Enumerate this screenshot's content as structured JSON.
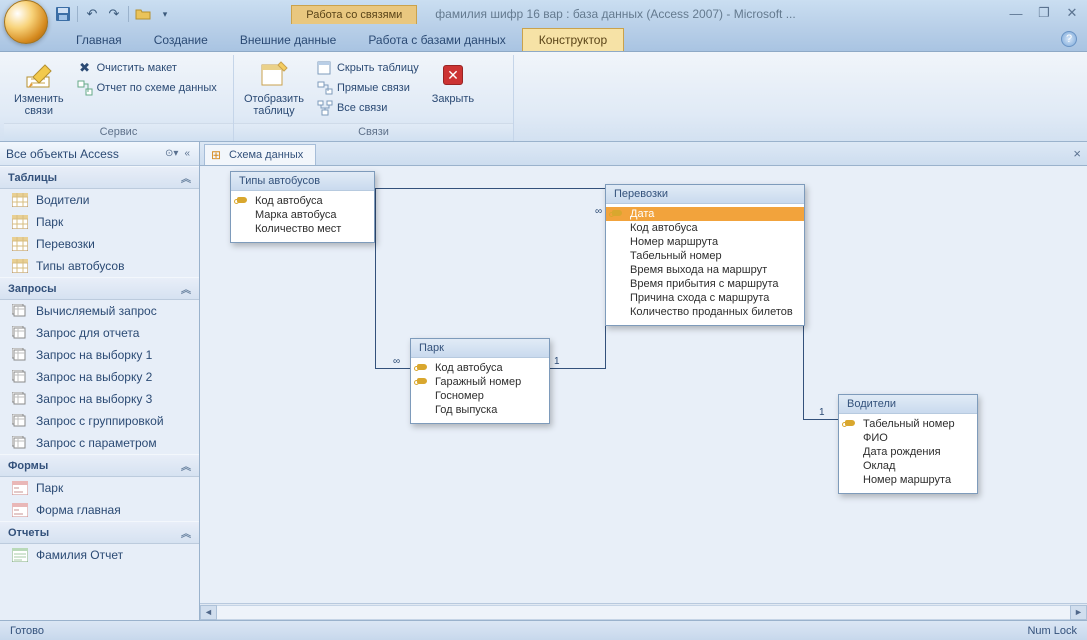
{
  "titlebar": {
    "context_title": "Работа со связями",
    "app_title": "фамилия шифр 16 вар : база данных (Access 2007) - Microsoft ..."
  },
  "tabs": {
    "items": [
      "Главная",
      "Создание",
      "Внешние данные",
      "Работа с базами данных"
    ],
    "context_tab": "Конструктор"
  },
  "ribbon": {
    "group1": {
      "label": "Сервис",
      "big": "Изменить\nсвязи",
      "clear": "Очистить макет",
      "report": "Отчет по схеме данных"
    },
    "group2": {
      "label": "Связи",
      "showtable": "Отобразить\nтаблицу",
      "hide": "Скрыть таблицу",
      "direct": "Прямые связи",
      "all": "Все связи",
      "close": "Закрыть"
    }
  },
  "nav": {
    "header": "Все объекты Access",
    "groups": [
      {
        "title": "Таблицы",
        "kind": "table",
        "items": [
          "Водители",
          "Парк",
          "Перевозки",
          "Типы автобусов"
        ]
      },
      {
        "title": "Запросы",
        "kind": "query",
        "items": [
          "Вычисляемый запрос",
          "Запрос для отчета",
          "Запрос на выборку 1",
          "Запрос на выборку 2",
          "Запрос на выборку 3",
          "Запрос с группировкой",
          "Запрос с параметром"
        ]
      },
      {
        "title": "Формы",
        "kind": "form",
        "items": [
          "Парк",
          "Форма главная"
        ]
      },
      {
        "title": "Отчеты",
        "kind": "report",
        "items": [
          "Фамилия Отчет"
        ]
      }
    ]
  },
  "doctab": "Схема данных",
  "boxes": {
    "types": {
      "title": "Типы автобусов",
      "fields": [
        {
          "n": "Код автобуса",
          "k": true
        },
        {
          "n": "Марка автобуса"
        },
        {
          "n": "Количество мест"
        }
      ]
    },
    "park": {
      "title": "Парк",
      "fields": [
        {
          "n": "Код автобуса",
          "k": true
        },
        {
          "n": "Гаражный номер",
          "k": true
        },
        {
          "n": "Госномер"
        },
        {
          "n": "Год выпуска"
        }
      ]
    },
    "trips": {
      "title": "Перевозки",
      "fields": [
        {
          "n": "Дата",
          "k": true,
          "sel": true
        },
        {
          "n": "Код автобуса"
        },
        {
          "n": "Номер маршрута"
        },
        {
          "n": "Табельный номер"
        },
        {
          "n": "Время выхода на маршрут"
        },
        {
          "n": "Время прибытия с маршрута"
        },
        {
          "n": "Причина схода с маршрута"
        },
        {
          "n": "Количество проданных билетов"
        }
      ]
    },
    "drivers": {
      "title": "Водители",
      "fields": [
        {
          "n": "Табельный номер",
          "k": true
        },
        {
          "n": "ФИО"
        },
        {
          "n": "Дата рождения"
        },
        {
          "n": "Оклад"
        },
        {
          "n": "Номер маршрута"
        }
      ]
    }
  },
  "status": {
    "left": "Готово",
    "right": "Num Lock"
  }
}
